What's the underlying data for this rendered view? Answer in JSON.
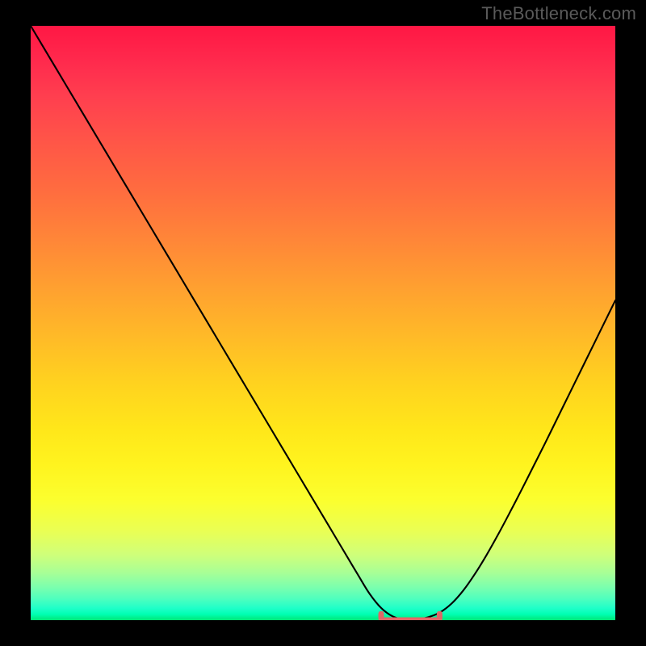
{
  "watermark": "TheBottleneck.com",
  "colors": {
    "frame": "#000000",
    "watermark": "#5a5a5a",
    "curve": "#000000",
    "markerFill": "#e06666",
    "markerStroke": "#c0392b"
  },
  "chart_data": {
    "type": "line",
    "title": "",
    "xlabel": "",
    "ylabel": "",
    "xlim": [
      0,
      100
    ],
    "ylim": [
      0,
      100
    ],
    "x": [
      0,
      2,
      4,
      6,
      8,
      10,
      12,
      14,
      16,
      18,
      20,
      22,
      24,
      26,
      28,
      30,
      32,
      34,
      36,
      38,
      40,
      42,
      44,
      46,
      48,
      50,
      52,
      54,
      56,
      58,
      60,
      62,
      64,
      66,
      68,
      70,
      72,
      74,
      76,
      78,
      80,
      82,
      84,
      86,
      88,
      90,
      92,
      94,
      96,
      98,
      100
    ],
    "values": [
      100,
      96.7,
      93.4,
      90.1,
      86.8,
      83.5,
      80.2,
      76.9,
      73.6,
      70.3,
      67.0,
      63.7,
      60.4,
      57.1,
      53.8,
      50.5,
      47.2,
      43.9,
      40.6,
      37.3,
      34.0,
      30.7,
      27.4,
      24.1,
      20.8,
      17.5,
      14.2,
      10.9,
      7.6,
      4.4,
      2.0,
      0.6,
      0.1,
      0.1,
      0.5,
      1.3,
      2.8,
      5.0,
      7.8,
      11.0,
      14.5,
      18.2,
      22.0,
      25.9,
      29.8,
      33.8,
      37.8,
      41.8,
      45.8,
      49.8,
      53.8
    ],
    "marker_segment": {
      "x_start": 60,
      "x_end": 70,
      "y": 0.1
    },
    "grid": false,
    "legend": false
  }
}
